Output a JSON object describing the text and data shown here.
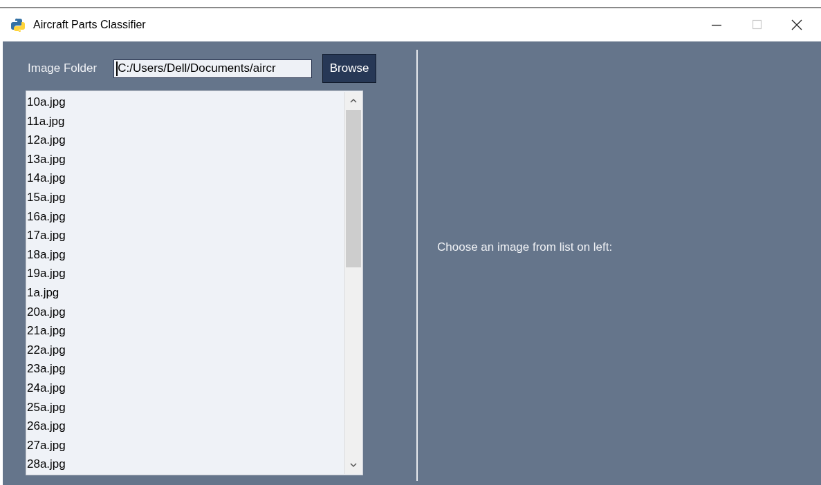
{
  "window": {
    "title": "Aircraft Parts Classifier",
    "controls": [
      {
        "kind": "minimize",
        "disabled": false
      },
      {
        "kind": "maximize",
        "disabled": true
      },
      {
        "kind": "close",
        "disabled": false
      }
    ]
  },
  "folder": {
    "label": "Image Folder",
    "value": "C:/Users/Dell/Documents/aircr",
    "button": "Browse"
  },
  "files": [
    "10a.jpg",
    "11a.jpg",
    "12a.jpg",
    "13a.jpg",
    "14a.jpg",
    "15a.jpg",
    "16a.jpg",
    "17a.jpg",
    "18a.jpg",
    "19a.jpg",
    "1a.jpg",
    "20a.jpg",
    "21a.jpg",
    "22a.jpg",
    "23a.jpg",
    "24a.jpg",
    "25a.jpg",
    "26a.jpg",
    "27a.jpg",
    "28a.jpg"
  ],
  "preview": {
    "message": "Choose an image from list on left:"
  }
}
